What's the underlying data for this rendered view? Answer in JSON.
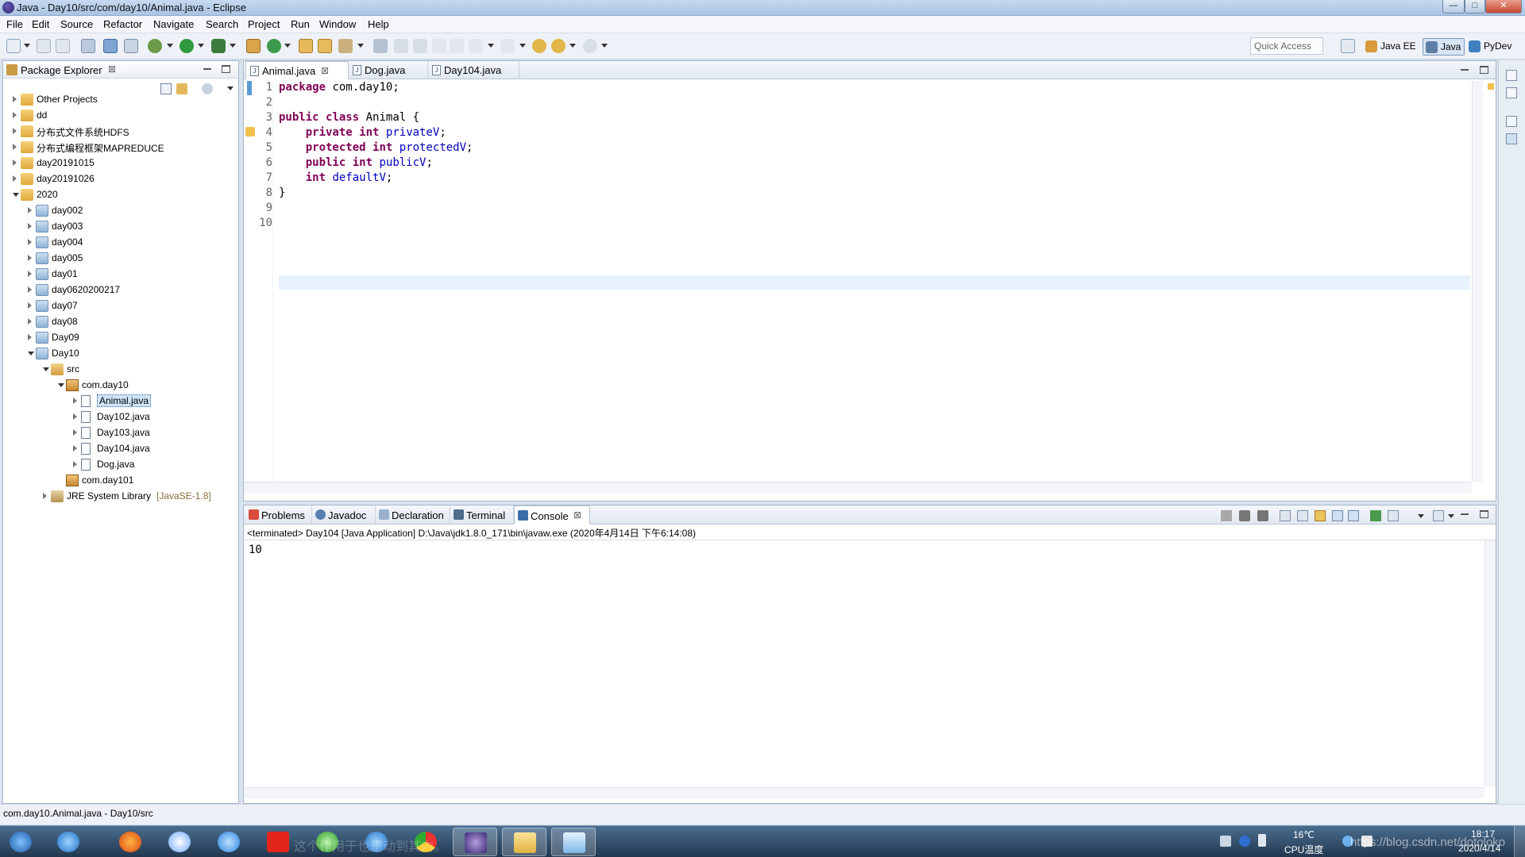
{
  "window": {
    "title": "Java - Day10/src/com/day10/Animal.java - Eclipse",
    "min_label": "—",
    "max_label": "□",
    "close_label": "✕"
  },
  "menu": [
    "File",
    "Edit",
    "Source",
    "Refactor",
    "Navigate",
    "Search",
    "Project",
    "Run",
    "Window",
    "Help"
  ],
  "toolbar": {
    "quick_access": "Quick Access",
    "perspectives": [
      "Java EE",
      "Java",
      "PyDev"
    ]
  },
  "package_explorer": {
    "title": "Package Explorer",
    "close_label": "⊠",
    "tree": [
      {
        "label": "Other Projects",
        "depth": 0,
        "state": "closed",
        "icon": "proj"
      },
      {
        "label": "dd",
        "depth": 0,
        "state": "closed",
        "icon": "proj"
      },
      {
        "label": "分布式文件系统HDFS",
        "depth": 0,
        "state": "closed",
        "icon": "proj"
      },
      {
        "label": "分布式编程框架MAPREDUCE",
        "depth": 0,
        "state": "closed",
        "icon": "proj"
      },
      {
        "label": "day20191015",
        "depth": 0,
        "state": "closed",
        "icon": "proj"
      },
      {
        "label": "day20191026",
        "depth": 0,
        "state": "closed",
        "icon": "proj"
      },
      {
        "label": "2020",
        "depth": 0,
        "state": "open",
        "icon": "proj"
      },
      {
        "label": "day002",
        "depth": 1,
        "state": "closed",
        "icon": "proj2"
      },
      {
        "label": "day003",
        "depth": 1,
        "state": "closed",
        "icon": "proj2"
      },
      {
        "label": "day004",
        "depth": 1,
        "state": "closed",
        "icon": "proj2"
      },
      {
        "label": "day005",
        "depth": 1,
        "state": "closed",
        "icon": "proj2"
      },
      {
        "label": "day01",
        "depth": 1,
        "state": "closed",
        "icon": "proj2"
      },
      {
        "label": "day0620200217",
        "depth": 1,
        "state": "closed",
        "icon": "proj2"
      },
      {
        "label": "day07",
        "depth": 1,
        "state": "closed",
        "icon": "proj2"
      },
      {
        "label": "day08",
        "depth": 1,
        "state": "closed",
        "icon": "proj2"
      },
      {
        "label": "Day09",
        "depth": 1,
        "state": "closed",
        "icon": "proj2"
      },
      {
        "label": "Day10",
        "depth": 1,
        "state": "open",
        "icon": "proj2"
      },
      {
        "label": "src",
        "depth": 2,
        "state": "open",
        "icon": "src"
      },
      {
        "label": "com.day10",
        "depth": 3,
        "state": "open",
        "icon": "pkg"
      },
      {
        "label": "Animal.java",
        "depth": 4,
        "state": "closed",
        "icon": "jfile",
        "selected": true
      },
      {
        "label": "Day102.java",
        "depth": 4,
        "state": "closed",
        "icon": "jfile"
      },
      {
        "label": "Day103.java",
        "depth": 4,
        "state": "closed",
        "icon": "jfile"
      },
      {
        "label": "Day104.java",
        "depth": 4,
        "state": "closed",
        "icon": "jfile"
      },
      {
        "label": "Dog.java",
        "depth": 4,
        "state": "closed",
        "icon": "jfile"
      },
      {
        "label": "com.day101",
        "depth": 3,
        "state": "none",
        "icon": "pkg"
      },
      {
        "label": "JRE System Library",
        "suffix": "[JavaSE-1.8]",
        "depth": 2,
        "state": "closed",
        "icon": "lib"
      }
    ]
  },
  "editor": {
    "tabs": [
      {
        "label": "Animal.java",
        "active": true,
        "close": "⊠"
      },
      {
        "label": "Dog.java",
        "active": false
      },
      {
        "label": "Day104.java",
        "active": false
      }
    ],
    "line_numbers": [
      "1",
      "2",
      "3",
      "4",
      "5",
      "6",
      "7",
      "8",
      "9",
      "10"
    ],
    "code": {
      "l1_kw": "package",
      "l1_rest": " com.day10;",
      "l3_kw1": "public",
      "l3_kw2": "class",
      "l3_rest": " Animal {",
      "l4_kw1": "private",
      "l4_kw2": "int",
      "l4_fld": "privateV",
      "l4_end": ";",
      "l5_kw1": "protected",
      "l5_kw2": "int",
      "l5_fld": "protectedV",
      "l5_end": ";",
      "l6_kw1": "public",
      "l6_kw2": "int",
      "l6_fld": "publicV",
      "l6_end": ";",
      "l7_kw": "int",
      "l7_fld": "defaultV",
      "l7_end": ";",
      "l8": "}"
    }
  },
  "console": {
    "tabs": [
      {
        "label": "Problems"
      },
      {
        "label": "Javadoc"
      },
      {
        "label": "Declaration"
      },
      {
        "label": "Terminal"
      },
      {
        "label": "Console",
        "active": true,
        "close": "⊠"
      }
    ],
    "status_line": "<terminated> Day104 [Java Application] D:\\Java\\jdk1.8.0_171\\bin\\javaw.exe (2020年4月14日 下午6:14:08)",
    "output": "10"
  },
  "statusbar": {
    "text": "com.day10.Animal.java - Day10/src"
  },
  "taskbar": {
    "temp": "16℃",
    "cpu_label": "CPU温度",
    "time": "18:17",
    "date": "2020/4/14",
    "ghost_text": "https://blog.csdn.net/dotoloko",
    "ghost_taskbar_text": "这个作用于也是动到其内。"
  },
  "colors": {
    "keyword": "#7f0055",
    "field": "#0000c0",
    "current_line": "#e8f2fe",
    "selection": "#cfe3f8"
  }
}
